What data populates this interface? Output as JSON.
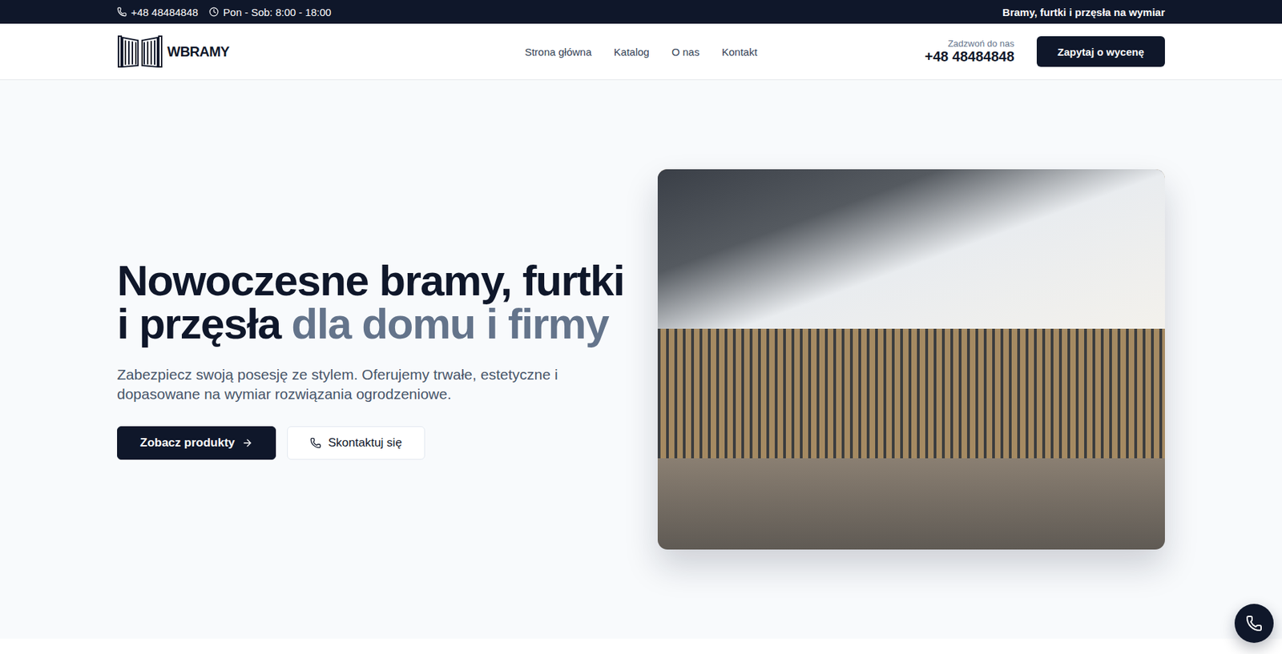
{
  "top_bar": {
    "phone": "+48 48484848",
    "hours": "Pon - Sob: 8:00 - 18:00",
    "tagline": "Bramy, furtki i przęsła na wymiar"
  },
  "header": {
    "logo": "WBRAMY",
    "nav": [
      {
        "label": "Strona główna"
      },
      {
        "label": "Katalog"
      },
      {
        "label": "O nas"
      },
      {
        "label": "Kontakt"
      }
    ],
    "call_label": "Zadzwoń do nas",
    "call_phone": "+48 48484848",
    "cta": "Zapytaj o wycenę"
  },
  "hero": {
    "title": "Nowoczesne bramy, furtki i przęsła ",
    "title_accent": "dla domu i firmy",
    "subtitle": "Zabezpiecz swoją posesję ze stylem. Oferujemy trwałe, estetyczne i dopasowane na wymiar rozwiązania ogrodzeniowe.",
    "buttons": [
      {
        "label": "Zobacz produkty",
        "kind": "primary"
      },
      {
        "label": "Skontaktuj się",
        "kind": "secondary"
      }
    ]
  }
}
